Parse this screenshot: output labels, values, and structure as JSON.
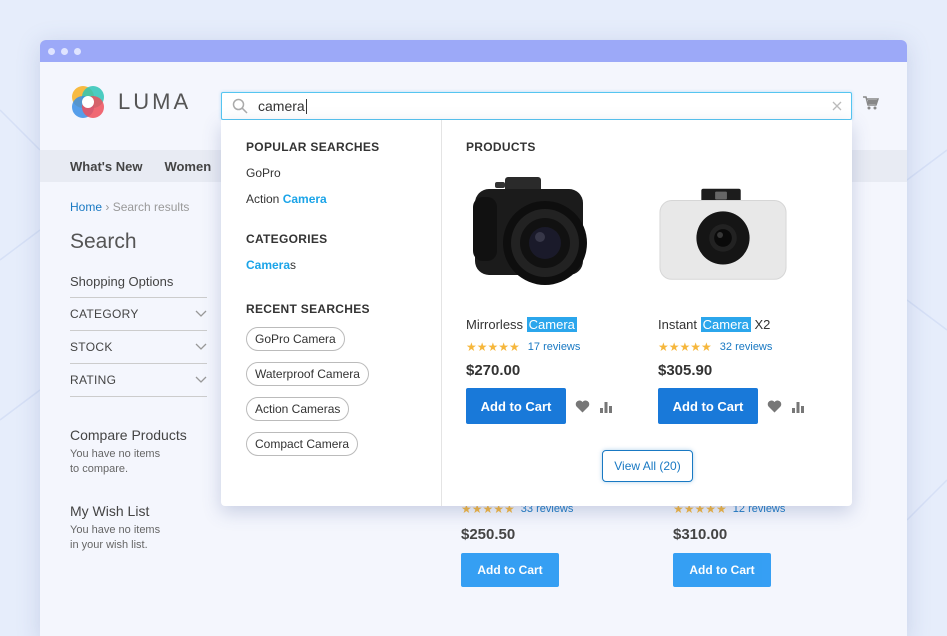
{
  "logo": {
    "text": "LUMA"
  },
  "search": {
    "value": "camera"
  },
  "nav": {
    "items": [
      "What's New",
      "Women"
    ]
  },
  "breadcrumb": {
    "home": "Home",
    "current": "Search results"
  },
  "page": {
    "title": "Search"
  },
  "sidebar": {
    "shopping_options": "Shopping Options",
    "filters": [
      "CATEGORY",
      "STOCK",
      "RATING"
    ],
    "compare": {
      "title": "Compare Products",
      "line1": "You have no items",
      "line2": "to compare."
    },
    "wishlist": {
      "title": "My Wish List",
      "line1": "You have no items",
      "line2": "in your wish list."
    }
  },
  "background_products": [
    {
      "reviews": "33 reviews",
      "price": "$250.50",
      "button": "Add to Cart",
      "stars": "★★★★★"
    },
    {
      "reviews": "12 reviews",
      "price": "$310.00",
      "button": "Add to Cart",
      "stars": "★★★★★"
    }
  ],
  "dropdown": {
    "popular": {
      "title": "POPULAR SEARCHES",
      "items": [
        {
          "prefix": "GoPro",
          "match": ""
        },
        {
          "prefix": "Action ",
          "match": "Camera"
        }
      ]
    },
    "categories": {
      "title": "CATEGORIES",
      "items": [
        {
          "match": "Camera",
          "suffix": "s"
        }
      ]
    },
    "recent": {
      "title": "RECENT SEARCHES",
      "items": [
        "GoPro Camera",
        "Waterproof Camera",
        "Action Cameras",
        "Compact Camera"
      ]
    },
    "products": {
      "title": "PRODUCTS",
      "items": [
        {
          "prefix": "Mirrorless ",
          "match": "Camera",
          "suffix": "",
          "stars": "★★★★★",
          "rating": 1.0,
          "reviews": "17 reviews",
          "price": "$270.00",
          "button": "Add to Cart",
          "icon": "dslr-camera-image"
        },
        {
          "prefix": "Instant ",
          "match": "Camera",
          "suffix": " X2",
          "stars": "★★★★★",
          "rating": 1.0,
          "reviews": "32 reviews",
          "price": "$305.90",
          "button": "Add to Cart",
          "icon": "instant-camera-image"
        }
      ]
    },
    "view_all": "View All (20)"
  },
  "colors": {
    "accent": "#1979d9",
    "highlight": "#2ba6ec",
    "star": "#f6b73c",
    "titlebar": "#9ca9f8"
  }
}
